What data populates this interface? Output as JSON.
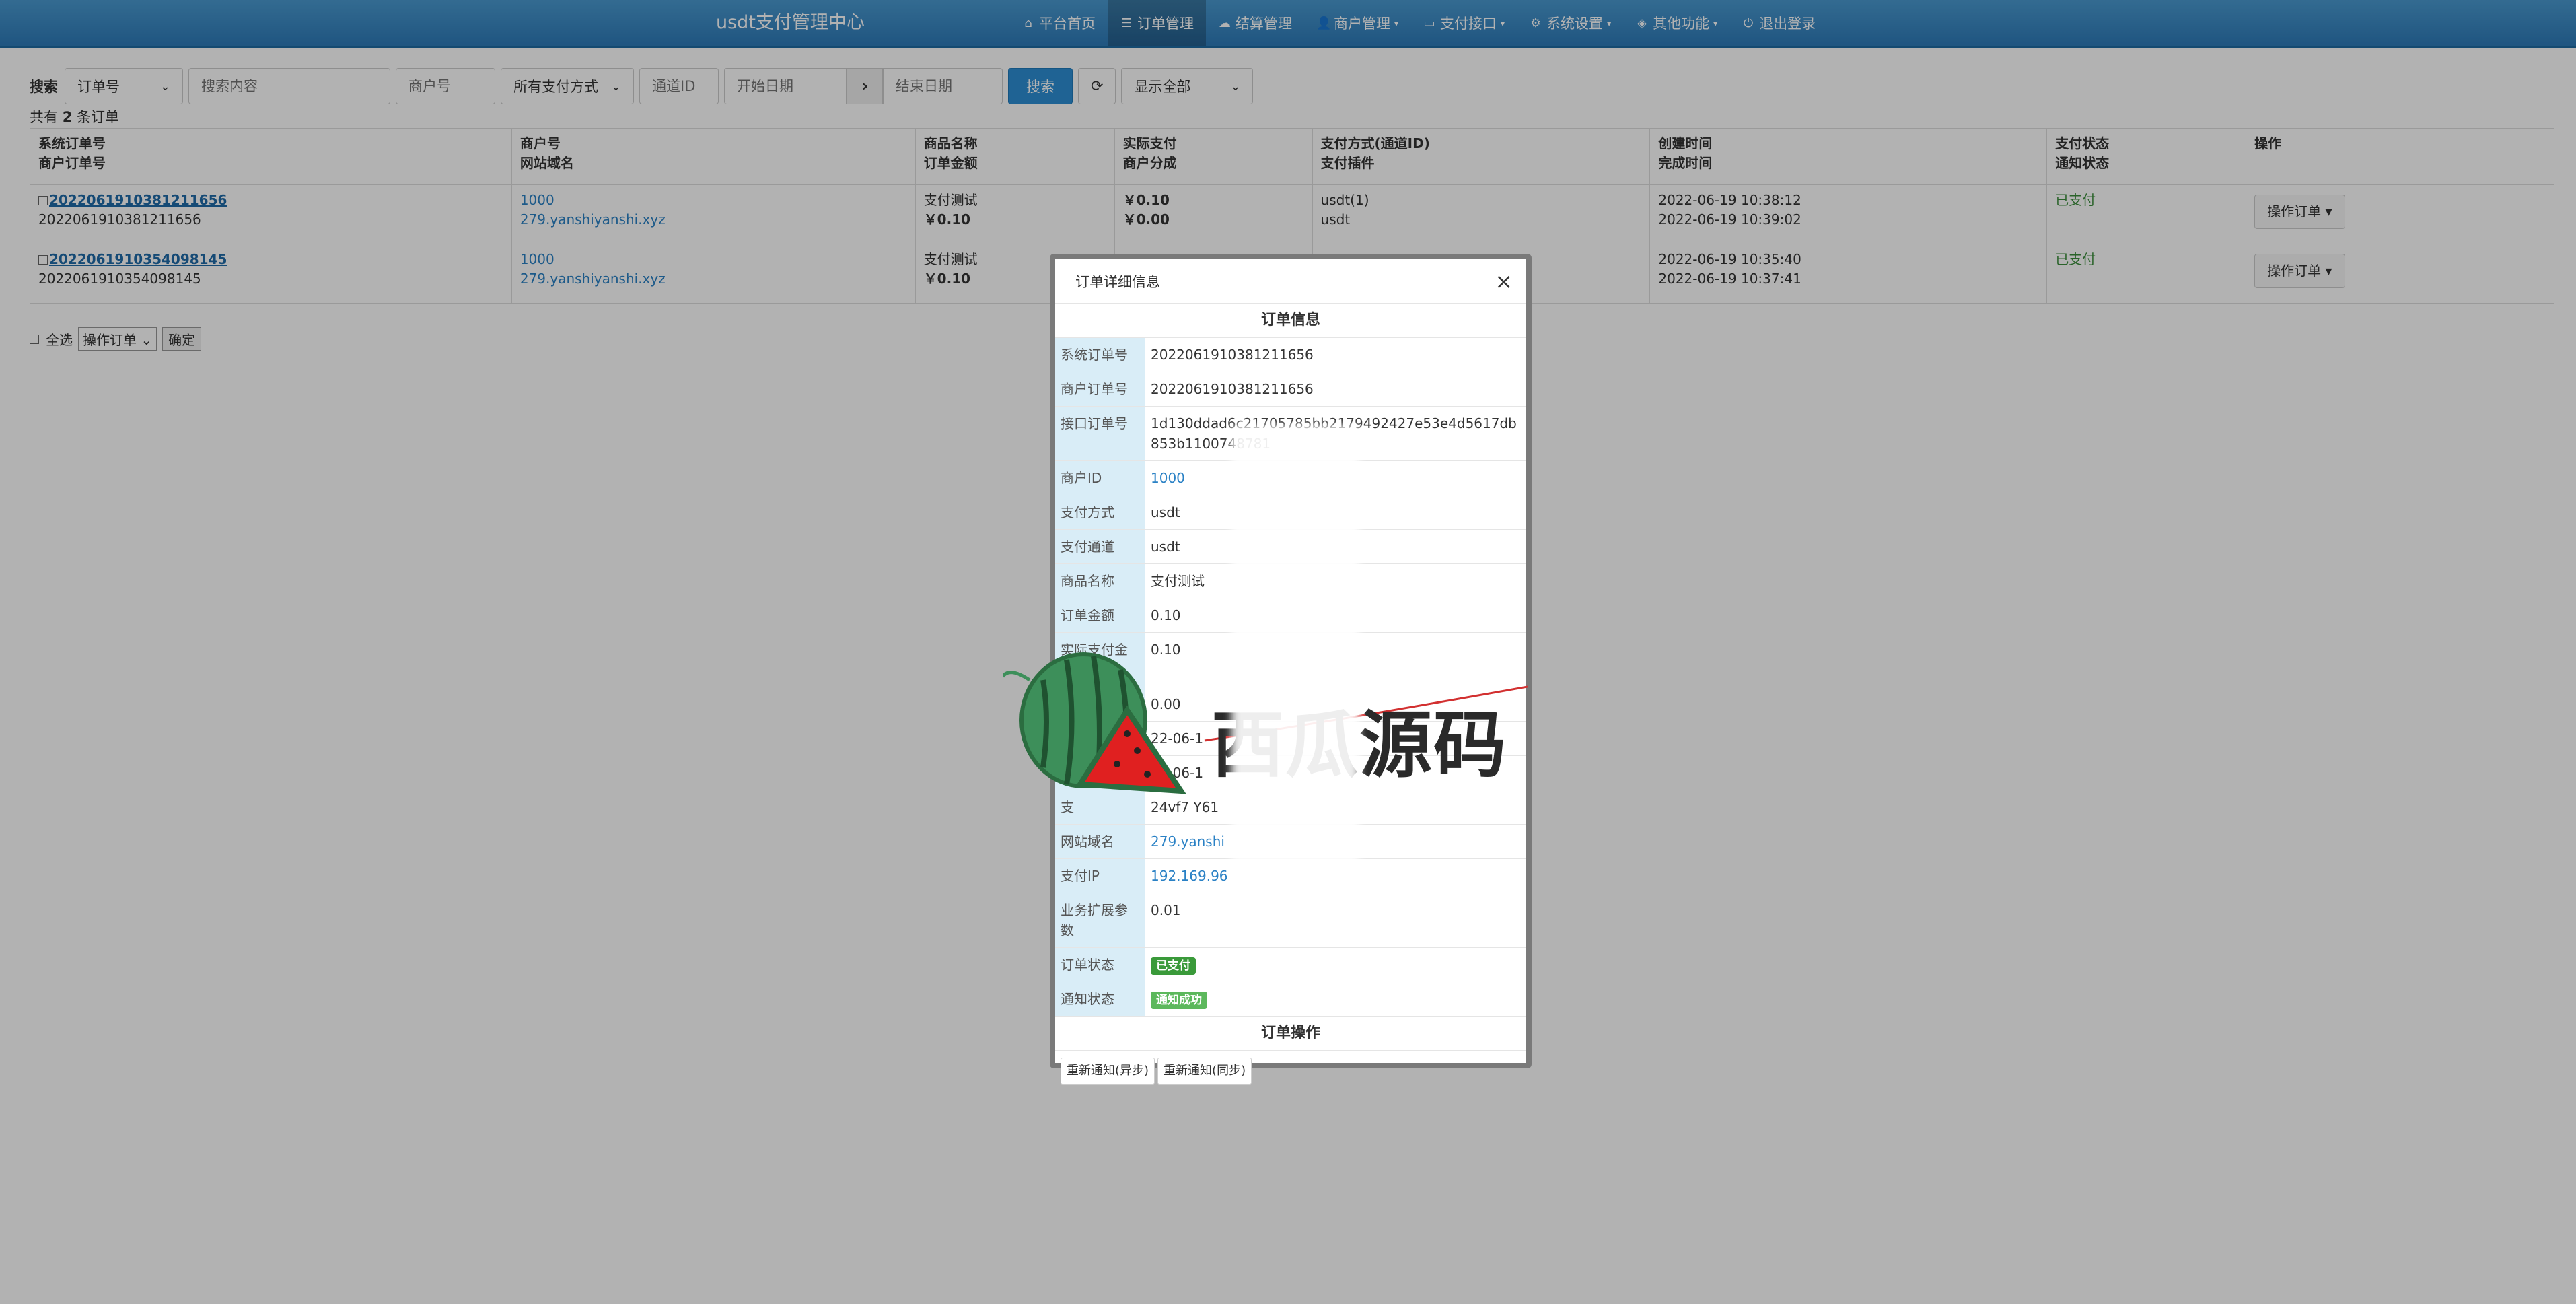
{
  "navbar": {
    "brand": "usdt支付管理中心",
    "items": [
      {
        "icon": "home-icon",
        "glyph": "⌂",
        "label": "平台首页",
        "active": false,
        "caret": false
      },
      {
        "icon": "list-icon",
        "glyph": "☰",
        "label": "订单管理",
        "active": true,
        "caret": false
      },
      {
        "icon": "cloud-icon",
        "glyph": "☁",
        "label": "结算管理",
        "active": false,
        "caret": false
      },
      {
        "icon": "user-icon",
        "glyph": "👤",
        "label": "商户管理",
        "active": false,
        "caret": true
      },
      {
        "icon": "card-icon",
        "glyph": "▭",
        "label": "支付接口",
        "active": false,
        "caret": true
      },
      {
        "icon": "gear-icon",
        "glyph": "⚙",
        "label": "系统设置",
        "active": false,
        "caret": true
      },
      {
        "icon": "cube-icon",
        "glyph": "◈",
        "label": "其他功能",
        "active": false,
        "caret": true
      },
      {
        "icon": "power-icon",
        "glyph": "⏻",
        "label": "退出登录",
        "active": false,
        "caret": false
      }
    ]
  },
  "search": {
    "label": "搜索",
    "type_select": "订单号",
    "content_placeholder": "搜索内容",
    "merchant_placeholder": "商户号",
    "paytype_select": "所有支付方式",
    "channel_placeholder": "通道ID",
    "start_placeholder": "开始日期",
    "arrow": "›",
    "end_placeholder": "结束日期",
    "submit": "搜索",
    "refresh_icon": "⟳",
    "display_select": "显示全部"
  },
  "count": {
    "prefix": "共有 ",
    "num": "2",
    "suffix": " 条订单"
  },
  "table": {
    "headers": [
      [
        "系统订单号",
        "商户订单号"
      ],
      [
        "商户号",
        "网站域名"
      ],
      [
        "商品名称",
        "订单金额"
      ],
      [
        "实际支付",
        "商户分成"
      ],
      [
        "支付方式(通道ID)",
        "支付插件"
      ],
      [
        "创建时间",
        "完成时间"
      ],
      [
        "支付状态",
        "通知状态"
      ],
      [
        "",
        "操作"
      ]
    ],
    "rows": [
      {
        "trade_no": "2022061910381211656",
        "out_trade_no": "2022061910381211656",
        "uid": "1000",
        "domain": "279.yanshiyanshi.xyz",
        "name": "支付测试",
        "money": "￥0.10",
        "realmoney": "￥0.10",
        "getmoney": "￥0.00",
        "type": "usdt(1)",
        "plugin": "usdt",
        "addtime": "2022-06-19 10:38:12",
        "endtime": "2022-06-19 10:39:02",
        "status": "已支付",
        "notify": "",
        "op": "操作订单"
      },
      {
        "trade_no": "2022061910354098145",
        "out_trade_no": "2022061910354098145",
        "uid": "1000",
        "domain": "279.yanshiyanshi.xyz",
        "name": "支付测试",
        "money": "￥0.10",
        "realmoney": "",
        "getmoney": "",
        "type": "",
        "plugin": "",
        "addtime": "2022-06-19 10:35:40",
        "endtime": "2022-06-19 10:37:41",
        "status": "已支付",
        "notify": "",
        "op": "操作订单"
      }
    ]
  },
  "bulk": {
    "select_all": "全选",
    "action_select": "操作订单",
    "confirm": "确定"
  },
  "modal": {
    "title": "订单详细信息",
    "close": "×",
    "section_info": "订单信息",
    "rows": [
      {
        "k": "系统订单号",
        "v": "2022061910381211656",
        "link": false
      },
      {
        "k": "商户订单号",
        "v": "2022061910381211656",
        "link": false
      },
      {
        "k": "接口订单号",
        "v": "1d130ddad6c21705785bb2179492427e53e4d5617db853b1100748781",
        "link": false
      },
      {
        "k": "商户ID",
        "v": "1000",
        "link": true
      },
      {
        "k": "支付方式",
        "v": "usdt",
        "link": false
      },
      {
        "k": "支付通道",
        "v": "usdt",
        "link": false
      },
      {
        "k": "商品名称",
        "v": "支付测试",
        "link": false
      },
      {
        "k": "订单金额",
        "v": "0.10",
        "link": false
      },
      {
        "k": "实际支付金额",
        "v": "0.10",
        "link": false
      },
      {
        "k": "",
        "v": "0.00",
        "link": false
      },
      {
        "k": "",
        "v": "22-06-1",
        "link": false
      },
      {
        "k": "",
        "v": "22-06-1",
        "link": false
      },
      {
        "k": "支",
        "v": "24vf7                      Y61",
        "link": false
      },
      {
        "k": "网站域名",
        "v": "279.yanshi",
        "link": true
      },
      {
        "k": "支付IP",
        "v": "192.169.96",
        "link": true
      },
      {
        "k": "业务扩展参数",
        "v": "0.01",
        "link": false
      }
    ],
    "order_status_label": "订单状态",
    "order_status": "已支付",
    "notify_status_label": "通知状态",
    "notify_status": "通知成功",
    "section_ops": "订单操作",
    "btn_async": "重新通知(异步)",
    "btn_sync": "重新通知(同步)"
  },
  "watermark": {
    "text": "西瓜源码"
  },
  "colors": {
    "nav": "#2d7ab8",
    "link": "#2a81c5",
    "paid": "#3c8e3c",
    "badge": "#5cb85c",
    "label_bg": "#d9edf7",
    "primary": "#2d8fd5"
  }
}
